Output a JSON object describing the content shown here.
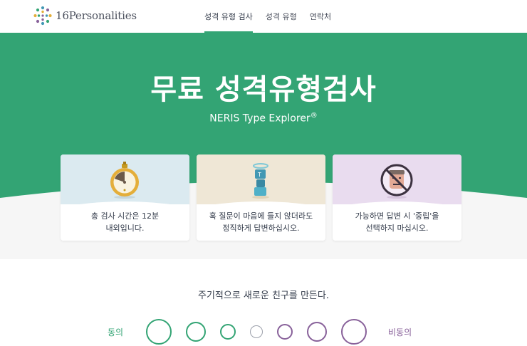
{
  "brand": {
    "name": "16Personalities"
  },
  "nav": {
    "items": [
      {
        "label": "성격 유형 검사",
        "active": true
      },
      {
        "label": "성격 유형",
        "active": false
      },
      {
        "label": "연락처",
        "active": false
      }
    ]
  },
  "hero": {
    "title": "무료 성격유형검사",
    "subtitle": "NERIS Type Explorer",
    "subtitle_mark": "®",
    "background": "#33a474"
  },
  "cards": [
    {
      "icon": "stopwatch-icon",
      "text": "총 검사 시간은 12분\n내외입니다.",
      "tint": "#dbeaf0"
    },
    {
      "icon": "honest-figure-icon",
      "text": "혹 질문이 마음에 들지 않더라도\n정직하게 답변하십시오.",
      "tint": "#efe7d6"
    },
    {
      "icon": "no-neutral-face-icon",
      "text": "가능하면 답변 시 '중립'을\n선택하지 마십시오.",
      "tint": "#e9dcef"
    }
  ],
  "question": {
    "text": "주기적으로 새로운 친구를 만든다.",
    "agree_label": "동의",
    "disagree_label": "비동의",
    "agree_color": "#33a474",
    "disagree_color": "#88619a",
    "neutral_color": "#9b9faa"
  }
}
